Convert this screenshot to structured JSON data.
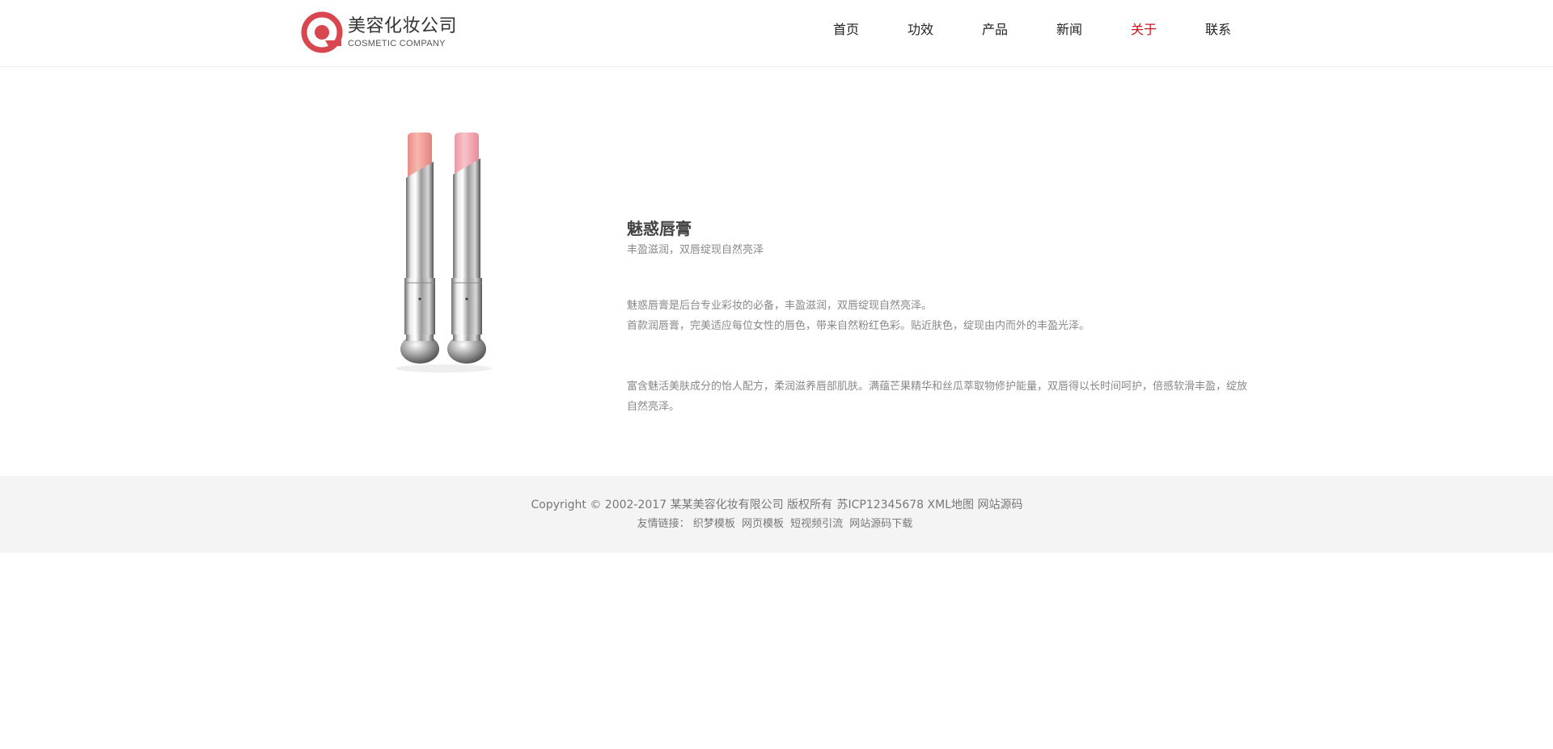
{
  "brand": {
    "name_cn": "美容化妆公司",
    "name_en": "COSMETIC COMPANY",
    "accent_color": "#c8161d",
    "logo_color": "#d9464f"
  },
  "nav": {
    "items": [
      {
        "label": "首页",
        "active": false
      },
      {
        "label": "功效",
        "active": false
      },
      {
        "label": "产品",
        "active": false
      },
      {
        "label": "新闻",
        "active": false
      },
      {
        "label": "关于",
        "active": true
      },
      {
        "label": "联系",
        "active": false
      }
    ]
  },
  "product": {
    "image_icon": "lipstick-pair-image",
    "title": "魅惑唇膏",
    "subtitle": "丰盈滋润，双唇绽现自然亮泽",
    "para1_line1": "魅惑唇膏是后台专业彩妆的必备，丰盈滋润，双唇绽现自然亮泽。",
    "para1_line2": "首款润唇膏，完美适应每位女性的唇色，带来自然粉红色彩。贴近肤色，绽现由内而外的丰盈光泽。",
    "para2": "富含魅活美肤成分的怡人配方，柔润滋养唇部肌肤。满蕴芒果精华和丝瓜萃取物修护能量，双唇得以长时间呵护，倍感软滑丰盈，绽放自然亮泽。"
  },
  "footer": {
    "copyright": "Copyright © 2002-2017 某某美容化妆有限公司 版权所有",
    "icp": "苏ICP12345678",
    "sitemap": "XML地图",
    "source": "网站源码",
    "links_label": "友情链接：",
    "links": [
      "织梦模板",
      "网页模板",
      "短视频引流",
      "网站源码下载"
    ]
  }
}
